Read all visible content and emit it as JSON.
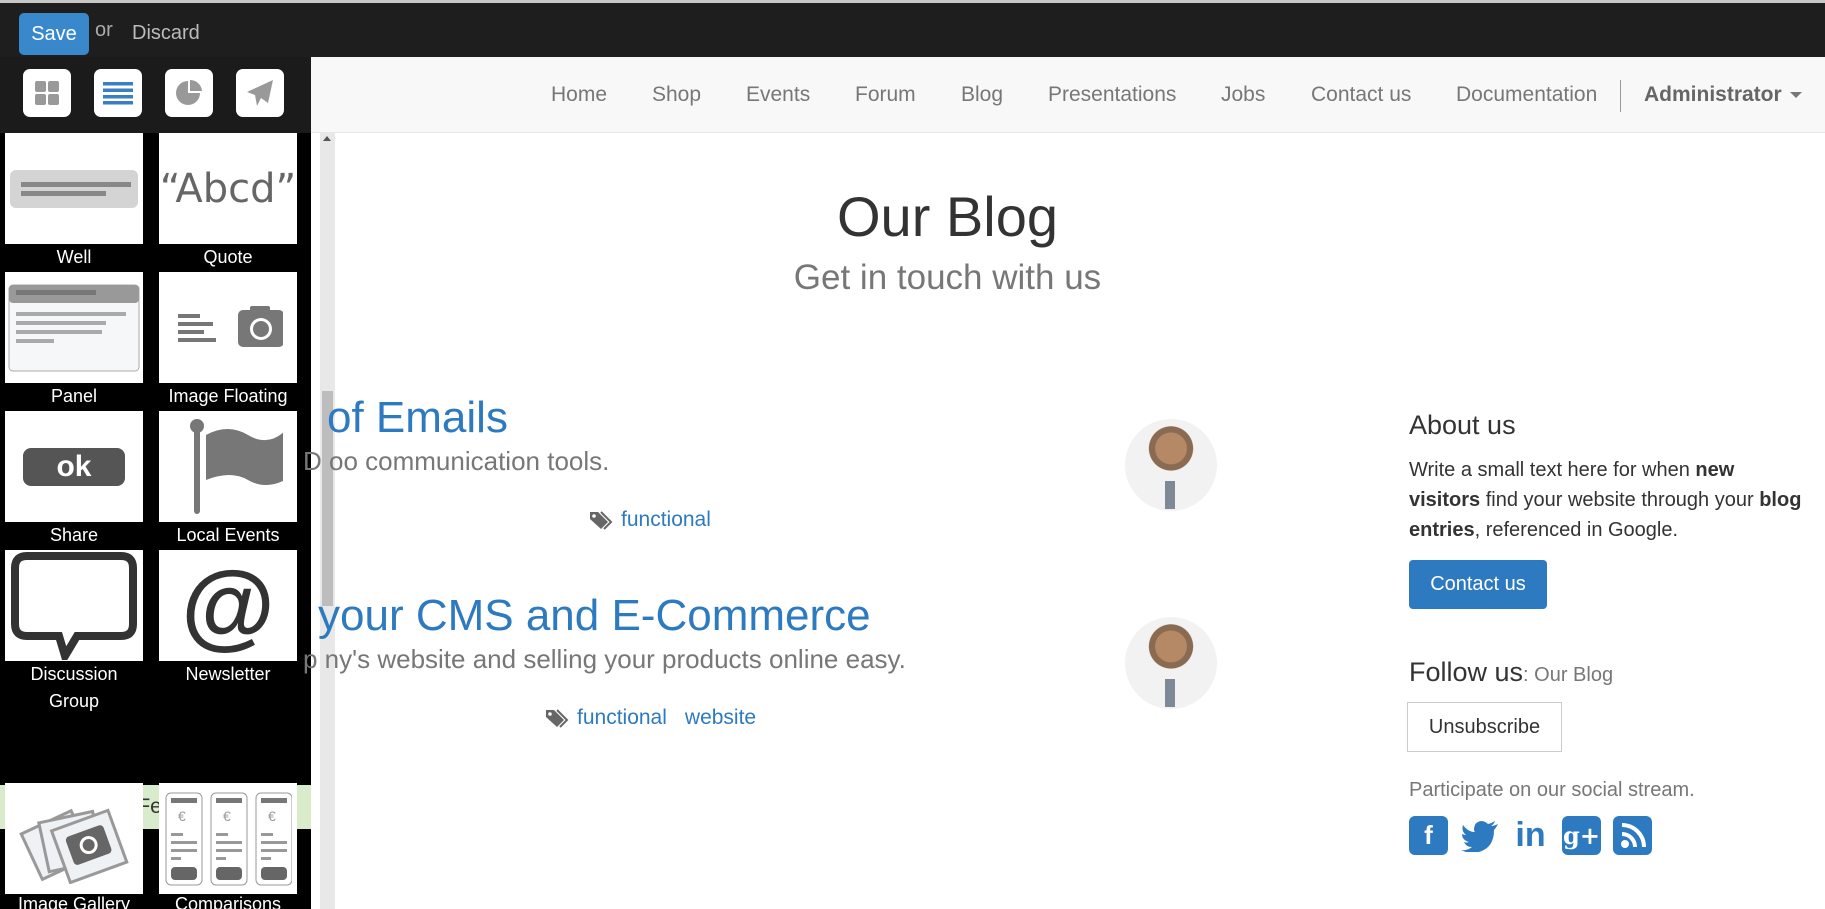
{
  "editor_bar": {
    "save_label": "Save",
    "or_label": "or",
    "discard_label": "Discard"
  },
  "sidebar": {
    "tabs": [
      {
        "icon": "grid-icon",
        "active": false
      },
      {
        "icon": "list-icon",
        "active": true
      },
      {
        "icon": "pie-chart-icon",
        "active": false
      },
      {
        "icon": "paper-plane-icon",
        "active": false
      }
    ],
    "snippets": [
      {
        "label": "Well",
        "icon": "well-icon"
      },
      {
        "label": "Quote",
        "icon": "quote-icon",
        "glyph": "“Abcd”"
      },
      {
        "label": "Panel",
        "icon": "panel-icon"
      },
      {
        "label": "Image Floating",
        "icon": "image-floating-icon"
      },
      {
        "label": "Share",
        "icon": "share-icon",
        "glyph": "ok"
      },
      {
        "label": "Local Events",
        "icon": "flag-icon"
      },
      {
        "label": "Discussion Group",
        "icon": "speech-bubble-icon"
      },
      {
        "label": "Newsletter",
        "icon": "at-sign-icon",
        "glyph": "@"
      }
    ],
    "feature_section": {
      "label": "Feature"
    },
    "feature_snippets": [
      {
        "label": "Image Gallery",
        "icon": "image-gallery-icon"
      },
      {
        "label": "Comparisons",
        "icon": "comparisons-icon"
      }
    ]
  },
  "navbar": {
    "items": [
      "Home",
      "Shop",
      "Events",
      "Forum",
      "Blog",
      "Presentations",
      "Jobs",
      "Contact us",
      "Documentation"
    ],
    "user": "Administrator"
  },
  "page": {
    "title": "Our Blog",
    "subtitle": "Get in touch with us"
  },
  "posts": [
    {
      "title": "of Emails",
      "teaser": "D oo communication tools.",
      "tags": [
        "functional"
      ]
    },
    {
      "title": "your CMS and E-Commerce",
      "teaser": "p ny's website and selling your products online easy.",
      "tags": [
        "functional",
        "website"
      ]
    }
  ],
  "aside": {
    "about_title": "About us",
    "about_text_1": "Write a small text here for when ",
    "about_bold_1": "new visitors",
    "about_text_2": " find your website through your ",
    "about_bold_2": "blog entries",
    "about_text_3": ", referenced in Google.",
    "contact_label": "Contact us",
    "follow_title": "Follow us",
    "follow_suffix": ": Our Blog",
    "unsubscribe_label": "Unsubscribe",
    "participate_text": "Participate on our social stream.",
    "social": [
      "facebook",
      "twitter",
      "linkedin",
      "google-plus",
      "rss"
    ]
  },
  "colors": {
    "accent": "#2d7ac0",
    "save": "#3a88cc",
    "feature_bg": "#d8eccb"
  }
}
